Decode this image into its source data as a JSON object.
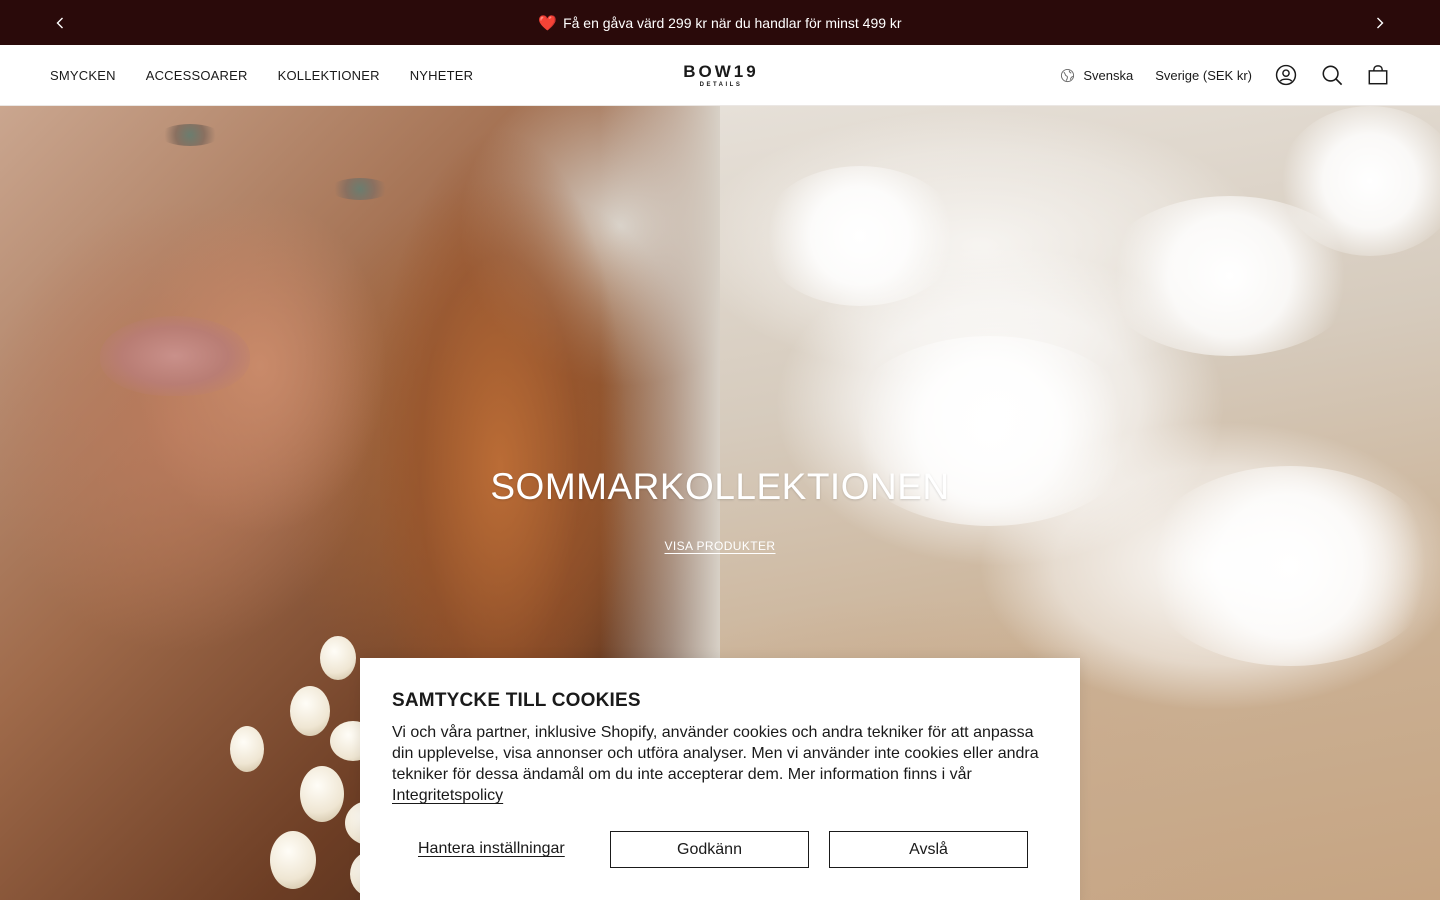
{
  "announcement": {
    "text": "Få en gåva värd 299 kr när du handlar för minst 499 kr",
    "icon": "heart-icon",
    "prev_icon": "chevron-left-icon",
    "next_icon": "chevron-right-icon",
    "background": "#2a0a0a"
  },
  "header": {
    "nav": [
      "SMYCKEN",
      "ACCESSOARER",
      "KOLLEKTIONER",
      "NYHETER"
    ],
    "logo": {
      "main": "BOW19",
      "sub": "DETAILS"
    },
    "language": "Svenska",
    "country": "Sverige (SEK kr)",
    "icons": [
      "globe-icon",
      "account-icon",
      "search-icon",
      "cart-icon"
    ]
  },
  "hero": {
    "title": "SOMMARKOLLEKTIONEN",
    "link": "VISA PRODUKTER"
  },
  "cookie_banner": {
    "title": "SAMTYCKE TILL COOKIES",
    "body": "Vi och våra partner, inklusive Shopify, använder cookies och andra tekniker för att anpassa din upplevelse, visa annonser och utföra analyser. Men vi använder inte cookies eller andra tekniker för dessa ändamål om du inte accepterar dem. Mer information finns i vår",
    "policy_link": "Integritetspolicy",
    "manage_label": "Hantera inställningar",
    "accept_label": "Godkänn",
    "decline_label": "Avslå"
  }
}
